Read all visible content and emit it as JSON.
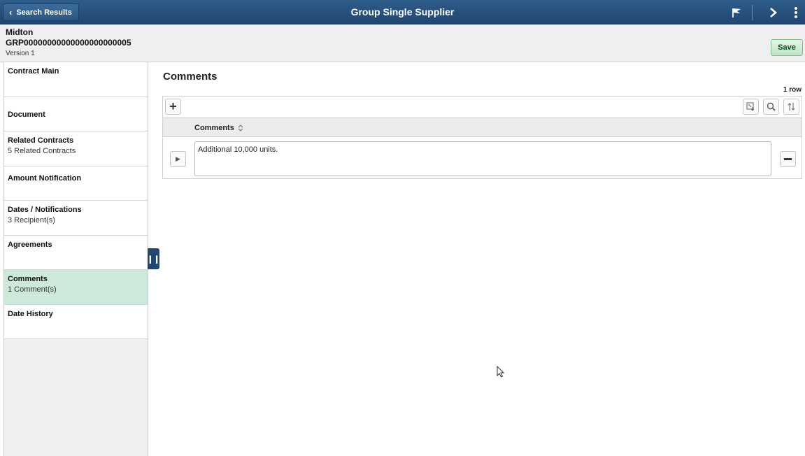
{
  "banner": {
    "back_label": "Search Results",
    "title": "Group Single Supplier"
  },
  "header": {
    "name": "Midton",
    "contract_id": "GRP00000000000000000000005",
    "version": "Version 1",
    "save_label": "Save"
  },
  "sidebar": {
    "items": [
      {
        "title": "Contract Main",
        "sub": ""
      },
      {
        "title": "Document",
        "sub": ""
      },
      {
        "title": "Related Contracts",
        "sub": "5 Related Contracts"
      },
      {
        "title": "Amount Notification",
        "sub": ""
      },
      {
        "title": "Dates / Notifications",
        "sub": "3 Recipient(s)"
      },
      {
        "title": "Agreements",
        "sub": ""
      },
      {
        "title": "Comments",
        "sub": "1 Comment(s)"
      },
      {
        "title": "Date History",
        "sub": ""
      }
    ],
    "active_index": 6
  },
  "main": {
    "title": "Comments",
    "row_count": "1 row",
    "grid": {
      "column_header": "Comments",
      "rows": [
        {
          "comment": "Additional 10,000 units."
        }
      ]
    }
  },
  "colors": {
    "banner": "#2f5c8a",
    "active_nav": "#cde9d9",
    "save_green": "#bfe3c7"
  },
  "icons": {
    "back": "chevron-left-icon",
    "flag": "flag-icon",
    "next": "chevron-right-icon",
    "more": "vertical-dots-icon",
    "add": "plus-icon",
    "export": "export-icon",
    "find": "search-icon",
    "sort": "sort-icon",
    "expand": "caret-right-icon",
    "delete": "minus-icon"
  }
}
